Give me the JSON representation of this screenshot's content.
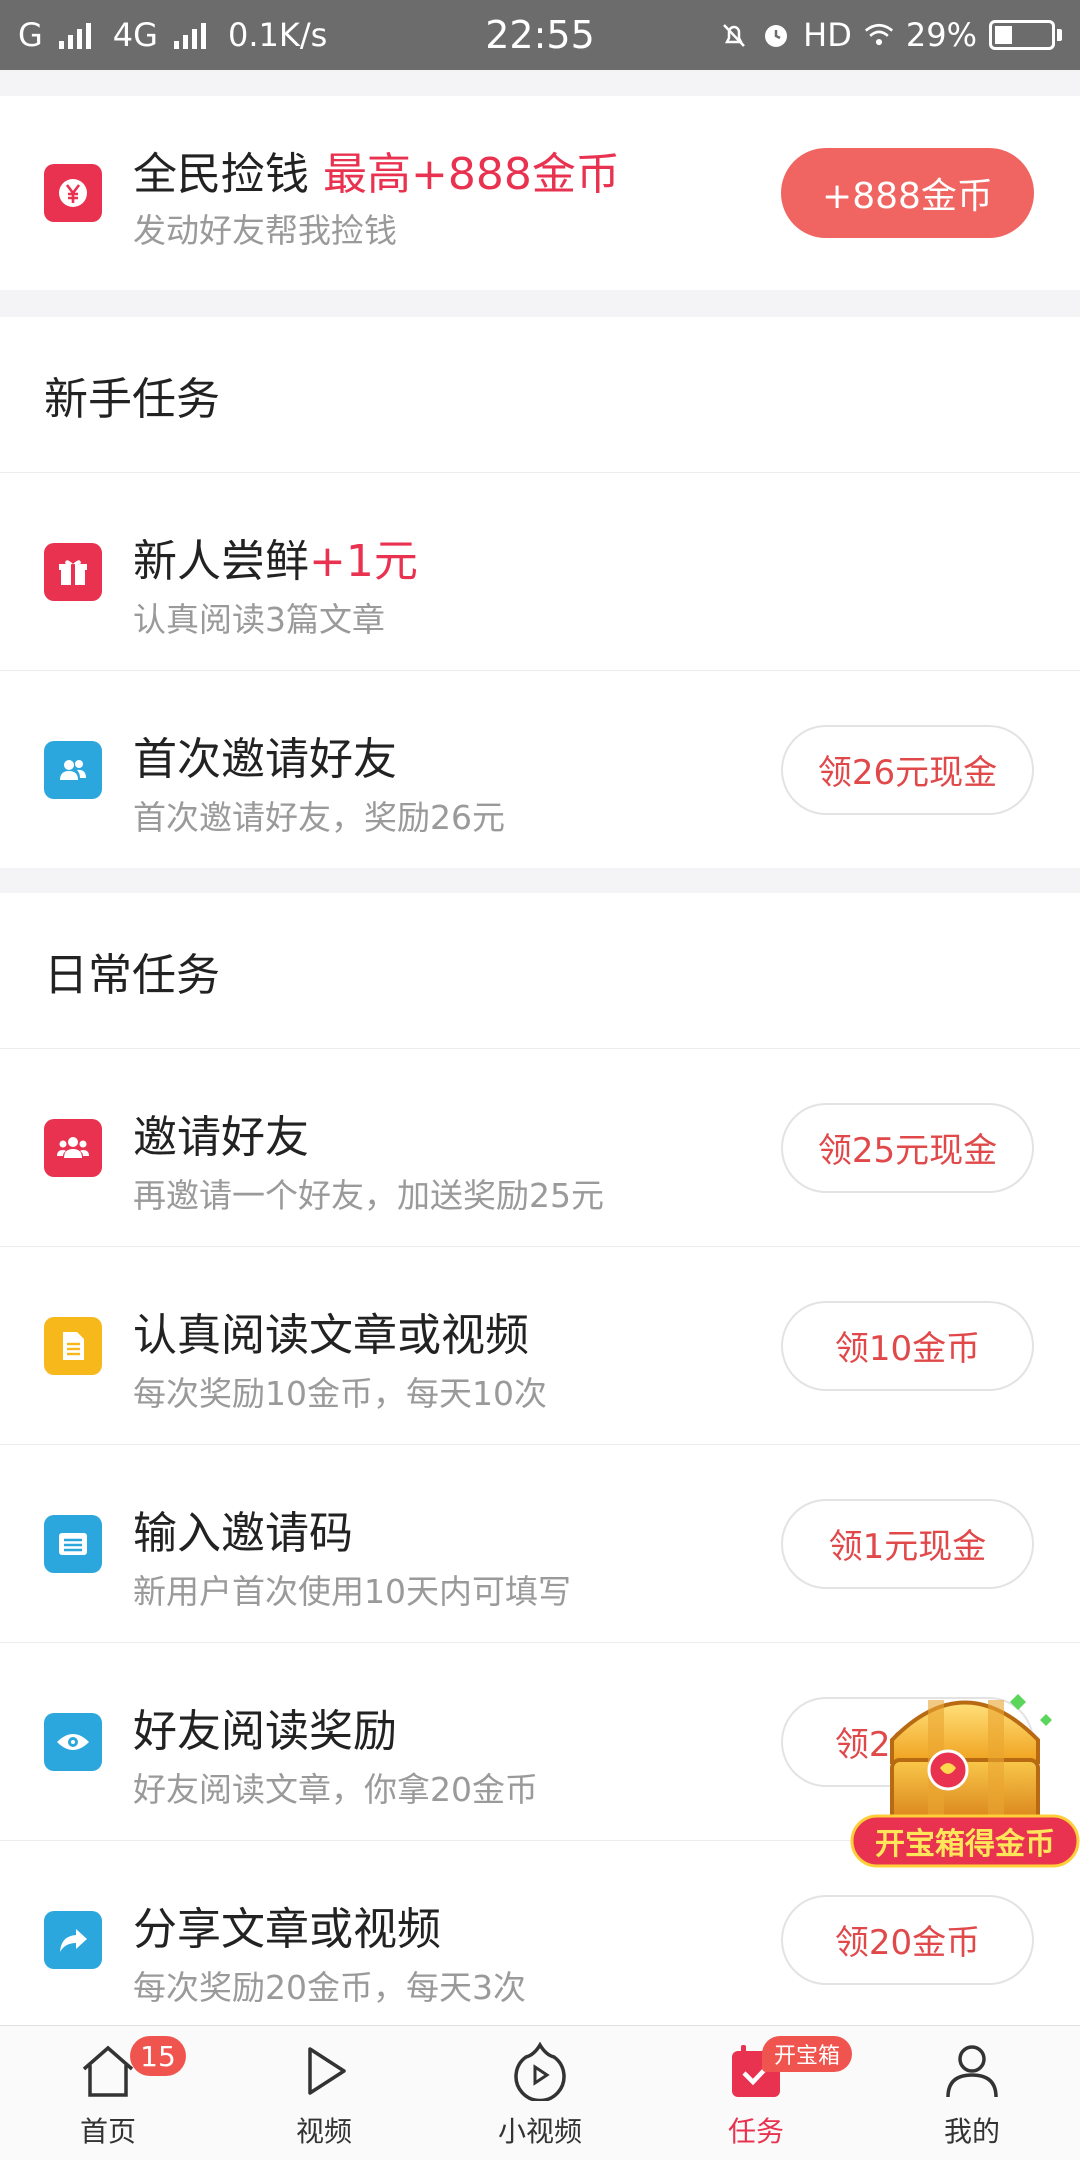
{
  "status_bar": {
    "carrier_left": "G",
    "network": "4G",
    "speed": "0.1K/s",
    "time": "22:55",
    "hd": "HD",
    "battery": "29%"
  },
  "promo": {
    "title": "全民捡钱",
    "highlight": "最高+888金币",
    "subtitle": "发动好友帮我捡钱",
    "button": "+888金币"
  },
  "newbie_section": {
    "heading": "新手任务",
    "items": [
      {
        "title": "新人尝鲜",
        "highlight": "+1元",
        "subtitle": "认真阅读3篇文章",
        "icon": "gift-icon"
      },
      {
        "title": "首次邀请好友",
        "subtitle": "首次邀请好友，奖励26元",
        "button": "领26元现金",
        "icon": "friends-icon"
      }
    ]
  },
  "daily_section": {
    "heading": "日常任务",
    "items": [
      {
        "title": "邀请好友",
        "subtitle": "再邀请一个好友，加送奖励25元",
        "button": "领25元现金",
        "icon": "group-icon"
      },
      {
        "title": "认真阅读文章或视频",
        "subtitle": "每次奖励10金币，每天10次",
        "button": "领10金币",
        "icon": "document-icon"
      },
      {
        "title": "输入邀请码",
        "subtitle": "新用户首次使用10天内可填写",
        "button": "领1元现金",
        "icon": "ticket-icon"
      },
      {
        "title": "好友阅读奖励",
        "subtitle": "好友阅读文章，你拿20金币",
        "button": "领20金币",
        "icon": "eye-icon"
      },
      {
        "title": "分享文章或视频",
        "subtitle": "每次奖励20金币，每天3次",
        "button": "领20金币",
        "icon": "share-icon"
      }
    ]
  },
  "treasure": {
    "label": "开宝箱得金币"
  },
  "bottom_nav": [
    {
      "label": "首页",
      "badge": "15"
    },
    {
      "label": "视频"
    },
    {
      "label": "小视频"
    },
    {
      "label": "任务",
      "tag": "开宝箱"
    },
    {
      "label": "我的"
    }
  ],
  "colors": {
    "accent": "#e8324f",
    "button": "#f06561",
    "status_bar": "#6c6c6c"
  }
}
